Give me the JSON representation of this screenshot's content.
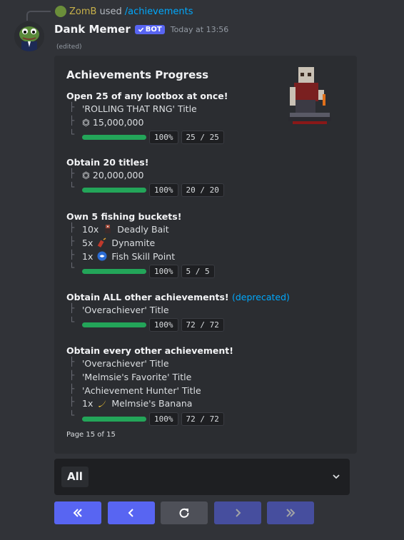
{
  "reply": {
    "username": "ZomB",
    "used_text": "used",
    "command": "/achievements"
  },
  "message": {
    "author": "Dank Memer",
    "bot_tag": "BOT",
    "timestamp": "Today at 13:56",
    "edited": "(edited)"
  },
  "embed": {
    "title": "Achievements Progress",
    "footer": "Page 15 of 15",
    "achievements": [
      {
        "title": "Open 25 of any lootbox at once!",
        "rewards": [
          {
            "text": "'ROLLING THAT RNG' Title",
            "icon": ""
          },
          {
            "text": "⏣ 15,000,000",
            "icon": ""
          }
        ],
        "percent": "100%",
        "count": "25 / 25",
        "progress": 1.0
      },
      {
        "title": "Obtain 20 titles!",
        "rewards": [
          {
            "text": "⏣ 20,000,000",
            "icon": ""
          }
        ],
        "percent": "100%",
        "count": "20 / 20",
        "progress": 1.0
      },
      {
        "title": "Own 5 fishing buckets!",
        "rewards": [
          {
            "qty": "10x",
            "icon": "deadly-bait-icon",
            "text": "Deadly Bait"
          },
          {
            "qty": "5x",
            "icon": "dynamite-icon",
            "text": "Dynamite"
          },
          {
            "qty": "1x",
            "icon": "fish-skill-point-icon",
            "text": "Fish Skill Point"
          }
        ],
        "percent": "100%",
        "count": "5 / 5",
        "progress": 1.0
      },
      {
        "title": "Obtain ALL other achievements!",
        "deprecated": "(deprecated)",
        "rewards": [
          {
            "text": "'Overachiever' Title",
            "icon": ""
          }
        ],
        "percent": "100%",
        "count": "72 / 72",
        "progress": 1.0
      },
      {
        "title": "Obtain every other achievement!",
        "rewards": [
          {
            "text": "'Overachiever' Title",
            "icon": ""
          },
          {
            "text": "'Melmsie's Favorite' Title",
            "icon": ""
          },
          {
            "text": "'Achievement Hunter' Title",
            "icon": ""
          },
          {
            "qty": "1x",
            "icon": "banana-icon",
            "text": "Melmsie's Banana"
          }
        ],
        "percent": "100%",
        "count": "72 / 72",
        "progress": 1.0
      }
    ]
  },
  "select": {
    "value": "All"
  },
  "buttons": [
    {
      "name": "first-page-button",
      "icon": "double-chevron-left-icon",
      "style": "primary"
    },
    {
      "name": "previous-page-button",
      "icon": "chevron-left-icon",
      "style": "primary"
    },
    {
      "name": "refresh-button",
      "icon": "refresh-icon",
      "style": "secondary"
    },
    {
      "name": "next-page-button",
      "icon": "chevron-right-icon",
      "style": "disabled"
    },
    {
      "name": "last-page-button",
      "icon": "double-chevron-right-icon",
      "style": "disabled"
    }
  ],
  "colors": {
    "blurple": "#5865f2",
    "progress_green": "#23a559",
    "link_blue": "#00a8fc",
    "username_gold": "#c7b14a"
  }
}
